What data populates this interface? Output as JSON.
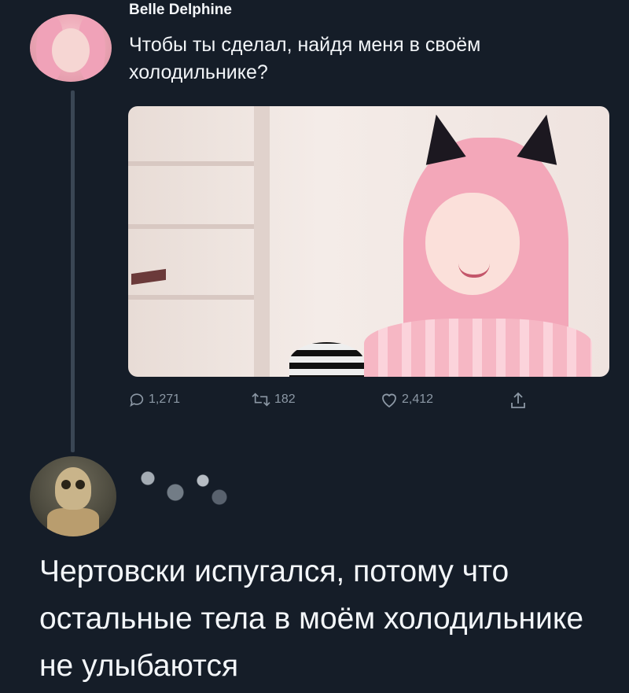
{
  "tweet": {
    "author": "Belle Delphine",
    "text": "Чтобы ты сделал, найдя меня в своём холодильнике?",
    "stats": {
      "replies": "1,271",
      "retweets": "182",
      "likes": "2,412"
    },
    "icons": {
      "reply": "reply-icon",
      "retweet": "retweet-icon",
      "like": "heart-icon",
      "share": "share-icon"
    }
  },
  "reply": {
    "text": "Чертовски испугался, потому что остальные тела в моём холодильнике не улыбаются"
  },
  "colors": {
    "background": "#151d28",
    "text": "#f2f5f8",
    "muted": "#8c98a5"
  }
}
